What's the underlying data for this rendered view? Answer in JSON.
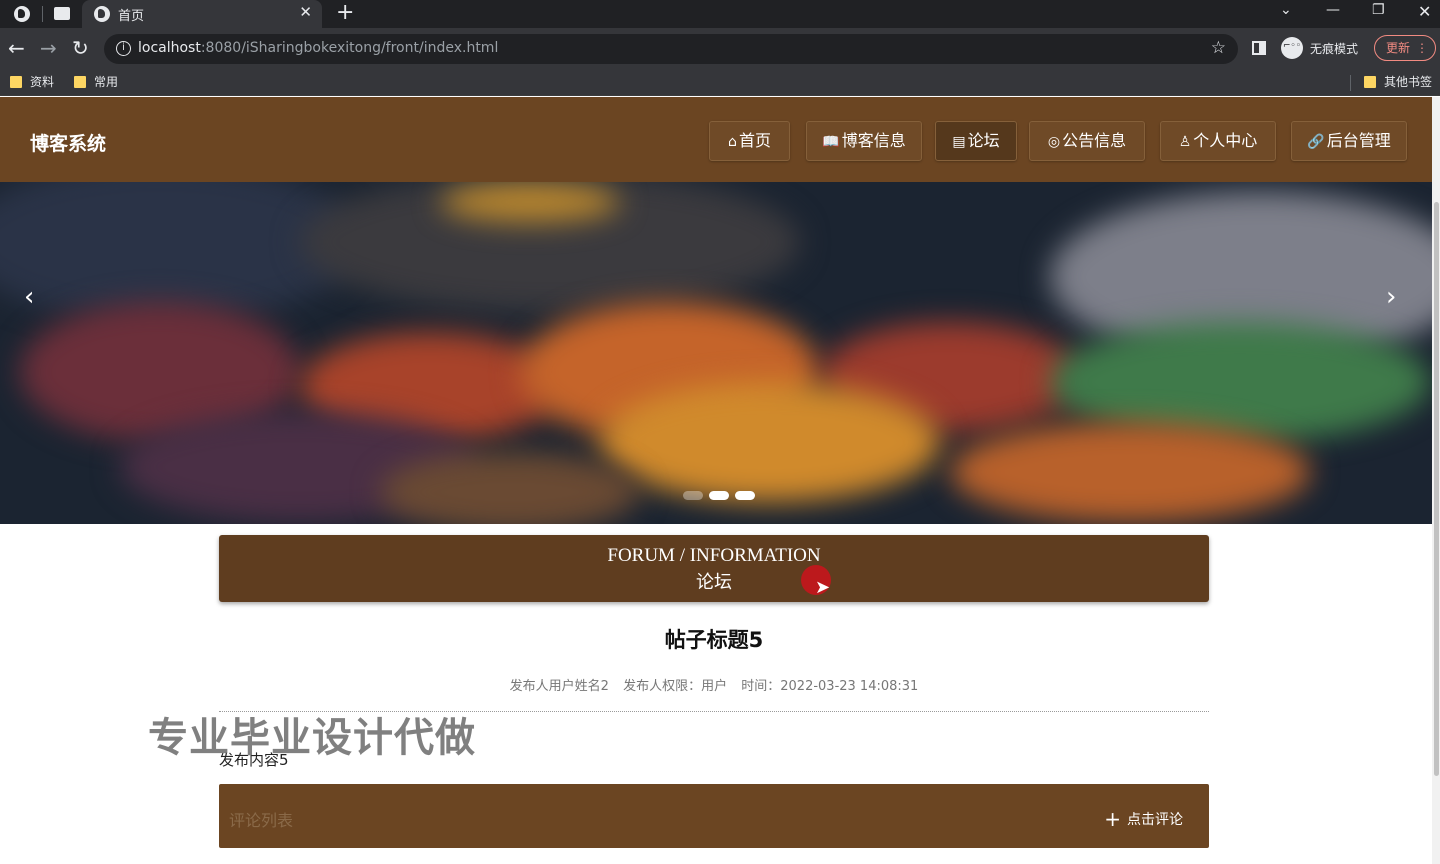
{
  "browser": {
    "tab_title": "首页",
    "url_host": "localhost",
    "url_rest": ":8080/iSharingbokexitong/front/index.html",
    "incognito_label": "无痕模式",
    "update_label": "更新",
    "bookmarks": [
      "资料",
      "常用"
    ],
    "other_bookmarks": "其他书签"
  },
  "site": {
    "title": "博客系统",
    "nav": [
      {
        "icon": "⌂",
        "label": "首页"
      },
      {
        "icon": "📖",
        "label": "博客信息"
      },
      {
        "icon": "▤",
        "label": "论坛"
      },
      {
        "icon": "◎",
        "label": "公告信息"
      },
      {
        "icon": "♙",
        "label": "个人中心"
      },
      {
        "icon": "🔗",
        "label": "后台管理"
      }
    ],
    "active_nav": "论坛"
  },
  "section": {
    "title_en": "FORUM / INFORMATION",
    "title_cn": "论坛"
  },
  "post": {
    "title": "帖子标题5",
    "author": "发布人用户姓名2",
    "role": "发布人权限：用户",
    "time": "时间：2022-03-23 14:08:31",
    "content": "发布内容5"
  },
  "watermark": "专业毕业设计代做",
  "comments": {
    "label": "评论列表",
    "button_label": "点击评论"
  },
  "colors": {
    "header_brown": "#6b4522",
    "section_brown": "#5f3d1f",
    "cursor_red": "#c4161c"
  }
}
